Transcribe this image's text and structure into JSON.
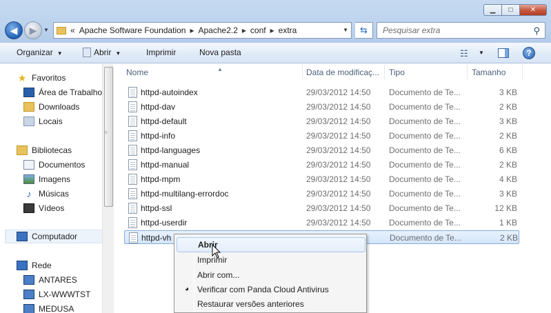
{
  "window": {
    "minimize_glyph": "▁",
    "maximize_glyph": "□",
    "close_glyph": "✕"
  },
  "address": {
    "prefix": "«",
    "crumbs": [
      "Apache Software Foundation",
      "Apache2.2",
      "conf",
      "extra"
    ],
    "separator": "▸"
  },
  "search": {
    "placeholder": "Pesquisar extra"
  },
  "toolbar": {
    "organize": "Organizar",
    "open": "Abrir",
    "print": "Imprimir",
    "new_folder": "Nova pasta"
  },
  "nav": {
    "favorites": "Favoritos",
    "desktop": "Área de Trabalho",
    "downloads": "Downloads",
    "places": "Locais",
    "libraries": "Bibliotecas",
    "documents": "Documentos",
    "images": "Imagens",
    "music": "Músicas",
    "videos": "Vídeos",
    "computer": "Computador",
    "network": "Rede",
    "hosts": [
      "ANTARES",
      "LX-WWWTST",
      "MEDUSA"
    ]
  },
  "columns": {
    "name": "Nome",
    "date": "Data de modificaç...",
    "type": "Tipo",
    "size": "Tamanho"
  },
  "files": [
    {
      "name": "httpd-autoindex",
      "date": "29/03/2012 14:50",
      "type": "Documento de Te...",
      "size": "3 KB"
    },
    {
      "name": "httpd-dav",
      "date": "29/03/2012 14:50",
      "type": "Documento de Te...",
      "size": "2 KB"
    },
    {
      "name": "httpd-default",
      "date": "29/03/2012 14:50",
      "type": "Documento de Te...",
      "size": "3 KB"
    },
    {
      "name": "httpd-info",
      "date": "29/03/2012 14:50",
      "type": "Documento de Te...",
      "size": "2 KB"
    },
    {
      "name": "httpd-languages",
      "date": "29/03/2012 14:50",
      "type": "Documento de Te...",
      "size": "6 KB"
    },
    {
      "name": "httpd-manual",
      "date": "29/03/2012 14:50",
      "type": "Documento de Te...",
      "size": "2 KB"
    },
    {
      "name": "httpd-mpm",
      "date": "29/03/2012 14:50",
      "type": "Documento de Te...",
      "size": "4 KB"
    },
    {
      "name": "httpd-multilang-errordoc",
      "date": "29/03/2012 14:50",
      "type": "Documento de Te...",
      "size": "3 KB"
    },
    {
      "name": "httpd-ssl",
      "date": "29/03/2012 14:50",
      "type": "Documento de Te...",
      "size": "12 KB"
    },
    {
      "name": "httpd-userdir",
      "date": "29/03/2012 14:50",
      "type": "Documento de Te...",
      "size": "1 KB"
    },
    {
      "name": "httpd-vh",
      "date": "",
      "type": "Documento de Te...",
      "size": "2 KB"
    }
  ],
  "context_menu": {
    "open": "Abrir",
    "print": "Imprimir",
    "open_with": "Abrir com...",
    "panda_scan": "Verificar com Panda Cloud Antivirus",
    "restore": "Restaurar versões anteriores"
  }
}
